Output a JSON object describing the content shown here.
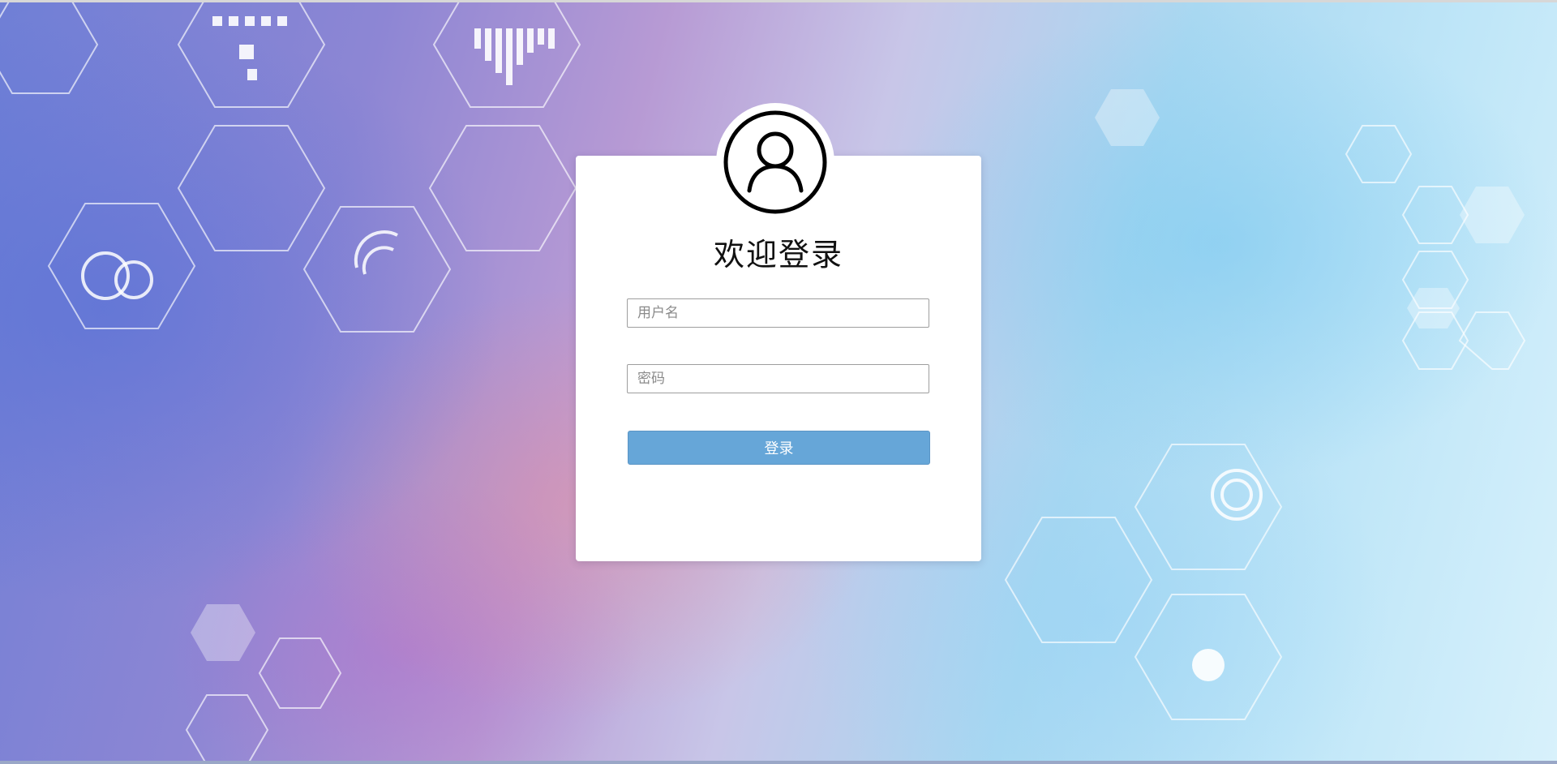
{
  "login": {
    "title": "欢迎登录",
    "username_placeholder": "用户名",
    "password_placeholder": "密码",
    "button_label": "登录"
  },
  "icons": {
    "avatar": "user-avatar-icon"
  },
  "colors": {
    "button": "#66a6d8",
    "card": "#ffffff",
    "title": "#111111"
  }
}
